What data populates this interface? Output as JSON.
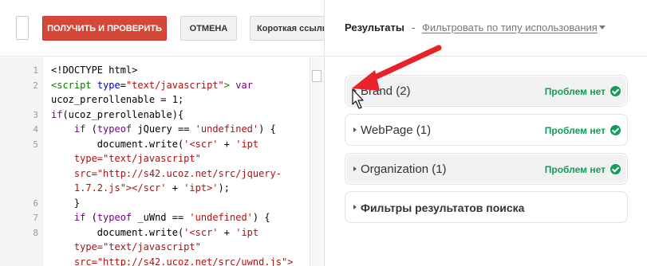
{
  "toolbar": {
    "get_check_label": "ПОЛУЧИТЬ И ПРОВЕРИТЬ",
    "cancel_label": "ОТМЕНА",
    "short_link_label": "Короткая ссылка"
  },
  "results_header": {
    "title": "Результаты",
    "separator": "-",
    "filter_label": "Фильтровать по типу использования"
  },
  "editor": {
    "line_numbers": [
      "1",
      "2",
      "",
      "3",
      "4",
      "5",
      "",
      "",
      "",
      "6",
      "7",
      "8",
      "",
      ""
    ]
  },
  "panels": [
    {
      "label": "Brand (2)",
      "status": "Проблем нет"
    },
    {
      "label": "WebPage (1)",
      "status": "Проблем нет"
    },
    {
      "label": "Organization (1)",
      "status": "Проблем нет"
    },
    {
      "label": "Фильтры результатов поиска"
    }
  ],
  "colors": {
    "primary_button": "#d34836",
    "ok_status": "#0f9d58",
    "annotation_arrow": "#e8222a"
  }
}
